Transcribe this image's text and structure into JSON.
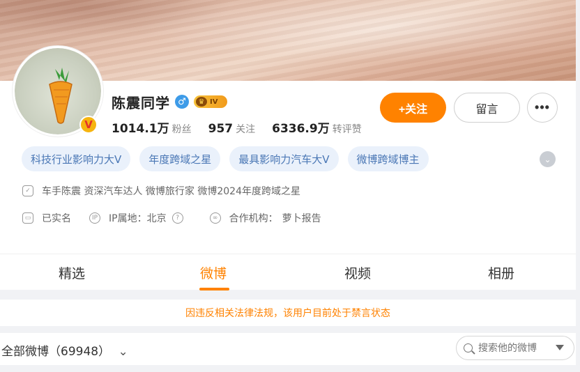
{
  "profile": {
    "name": "陈震同学",
    "verified_badge": "V",
    "level_badge": "IV",
    "stats": [
      {
        "value": "1014.1万",
        "label": "粉丝"
      },
      {
        "value": "957",
        "label": "关注"
      },
      {
        "value": "6336.9万",
        "label": "转评赞"
      }
    ]
  },
  "actions": {
    "follow": "+关注",
    "message": "留言",
    "more": "•••"
  },
  "tags": [
    "科技行业影响力大V",
    "年度跨域之星",
    "最具影响力汽车大V",
    "微博跨域博主"
  ],
  "info": {
    "bio": "车手陈震 资深汽车达人 微博旅行家 微博2024年度跨域之星",
    "realname": "已实名",
    "ip_label": "IP属地：北京",
    "ip_help": "?",
    "org_label": "合作机构：",
    "org_value": "萝卜报告"
  },
  "tabs": [
    "精选",
    "微博",
    "视频",
    "相册"
  ],
  "active_tab": "微博",
  "notice": "因违反相关法律法规，该用户目前处于禁言状态",
  "feed": {
    "label": "全部微博（69948）",
    "search_placeholder": "搜索他的微博"
  },
  "colors": {
    "accent": "#ff8200",
    "tag_bg": "#eaf1fb",
    "tag_text": "#4a77b5"
  }
}
